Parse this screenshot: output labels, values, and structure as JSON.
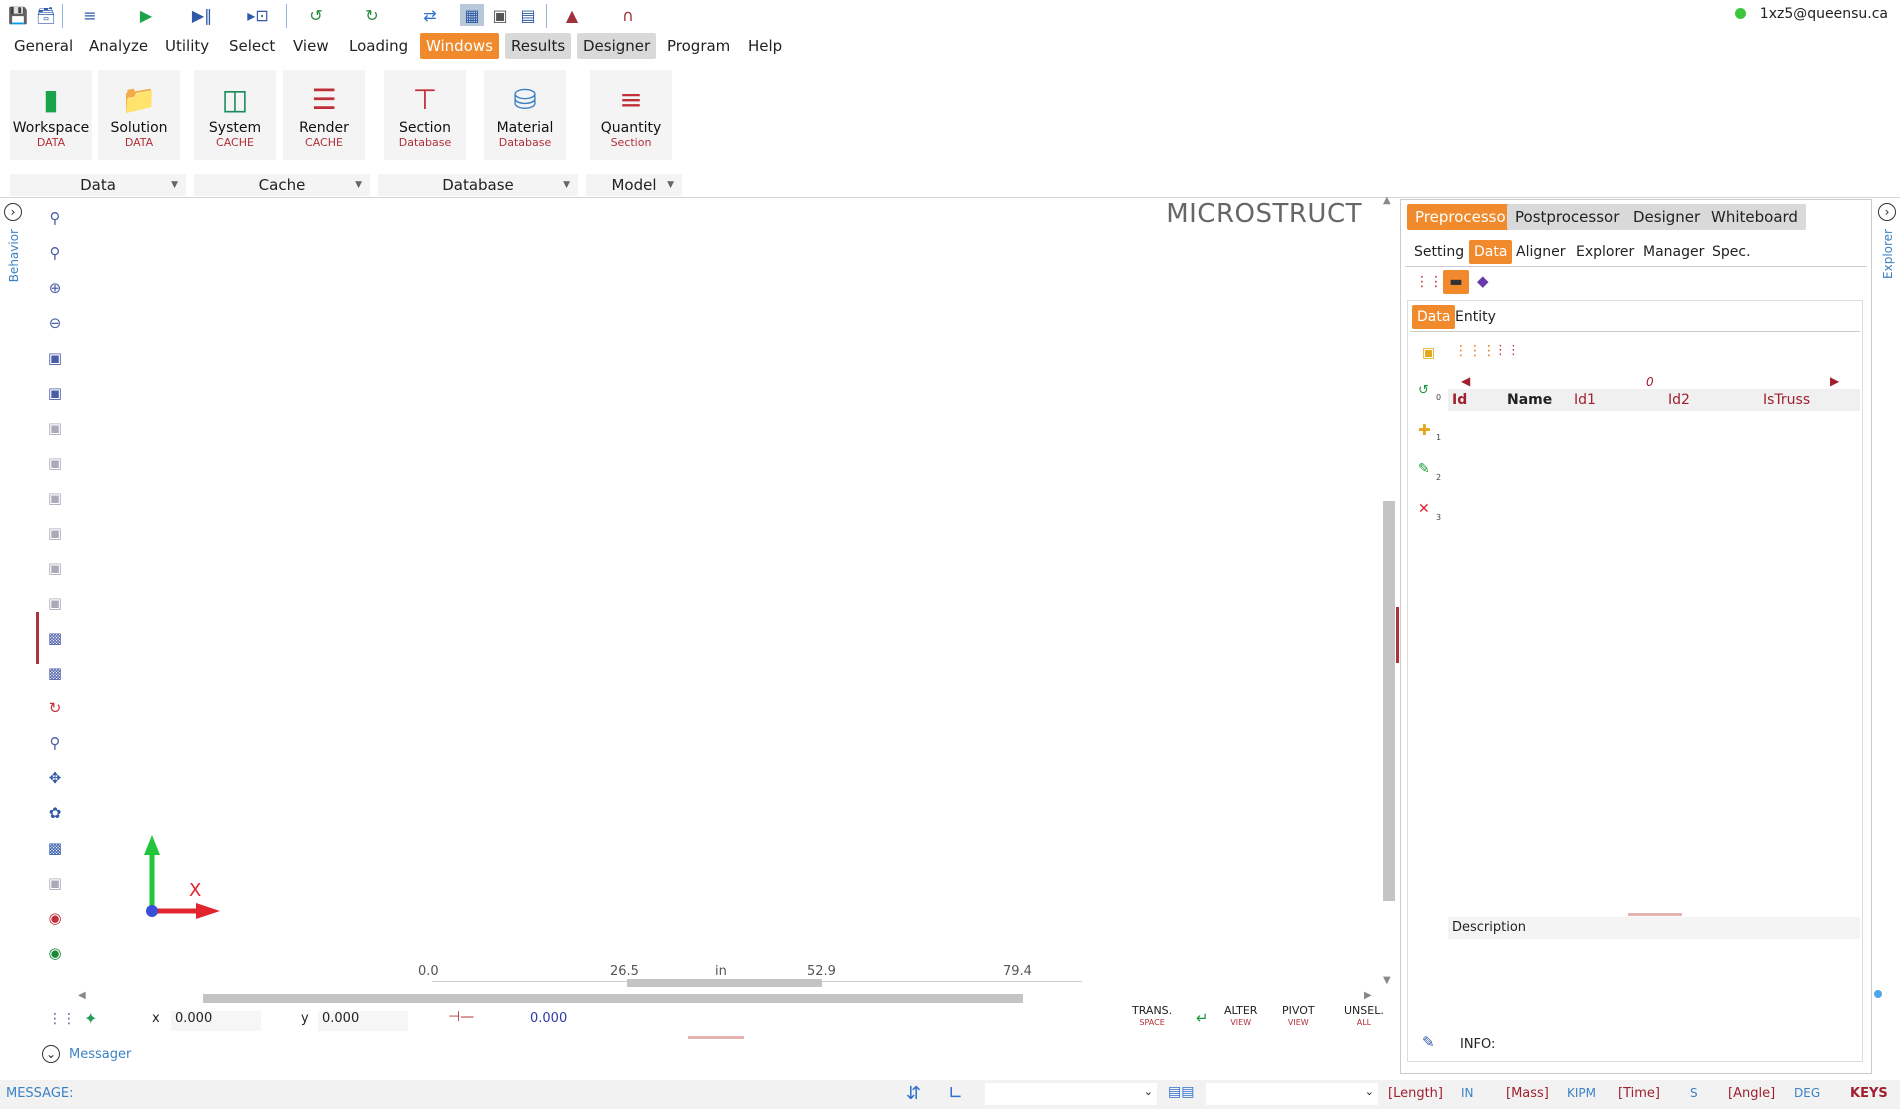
{
  "user": {
    "email": "1xz5@queensu.ca"
  },
  "menu": [
    "General",
    "Analyze",
    "Utility",
    "Select",
    "View",
    "Loading",
    "Windows",
    "Results",
    "Designer",
    "Program",
    "Help"
  ],
  "ribbon": {
    "buttons": [
      {
        "label": "Workspace",
        "sub": "DATA"
      },
      {
        "label": "Solution",
        "sub": "DATA"
      },
      {
        "label": "System",
        "sub": "CACHE"
      },
      {
        "label": "Render",
        "sub": "CACHE"
      },
      {
        "label": "Section",
        "sub": "Database"
      },
      {
        "label": "Material",
        "sub": "Database"
      },
      {
        "label": "Quantity",
        "sub": "Section"
      }
    ],
    "groups": [
      "Data",
      "Cache",
      "Database",
      "Model"
    ]
  },
  "left": {
    "behavior_label": "Behavior"
  },
  "canvas": {
    "brand": "MICROSTRUCT",
    "axis_label": "X",
    "ruler": {
      "ticks": [
        "0.0",
        "26.5",
        "52.9",
        "79.4"
      ],
      "unit": "in"
    }
  },
  "coords": {
    "x_label": "x",
    "x_value": "0.000",
    "y_label": "y",
    "y_value": "0.000",
    "d_value": "0.000"
  },
  "bottom_buttons": [
    {
      "label": "TRANS.",
      "sub": "SPACE"
    },
    {
      "label": "ALTER",
      "sub": "VIEW"
    },
    {
      "label": "PIVOT",
      "sub": "VIEW"
    },
    {
      "label": "UNSEL.",
      "sub": "ALL"
    }
  ],
  "messager": {
    "label": "Messager"
  },
  "status": {
    "message_label": "MESSAGE:",
    "units": [
      {
        "label": "[Length]",
        "value": "IN"
      },
      {
        "label": "[Mass]",
        "value": "KIPM"
      },
      {
        "label": "[Time]",
        "value": "S"
      },
      {
        "label": "[Angle]",
        "value": "DEG"
      }
    ],
    "keys": "KEYS"
  },
  "right": {
    "explorer_label": "Explorer",
    "main_tabs": [
      "Preprocessor",
      "Postprocessor",
      "Designer",
      "Whiteboard"
    ],
    "sub_tabs": [
      "Setting",
      "Data",
      "Aligner",
      "Explorer",
      "Manager",
      "Spec."
    ],
    "inner_tabs": [
      "Data",
      "Entity"
    ],
    "page_index": "0",
    "columns": [
      "Id",
      "Name",
      "Id1",
      "Id2",
      "IsTruss"
    ],
    "row_numbers": [
      "0",
      "1",
      "2",
      "3"
    ],
    "description_label": "Description",
    "info_label": "INFO:"
  },
  "colors": {
    "accent": "#f08a2d",
    "unit_blue": "#3b82c4",
    "label_red": "#a02030"
  }
}
